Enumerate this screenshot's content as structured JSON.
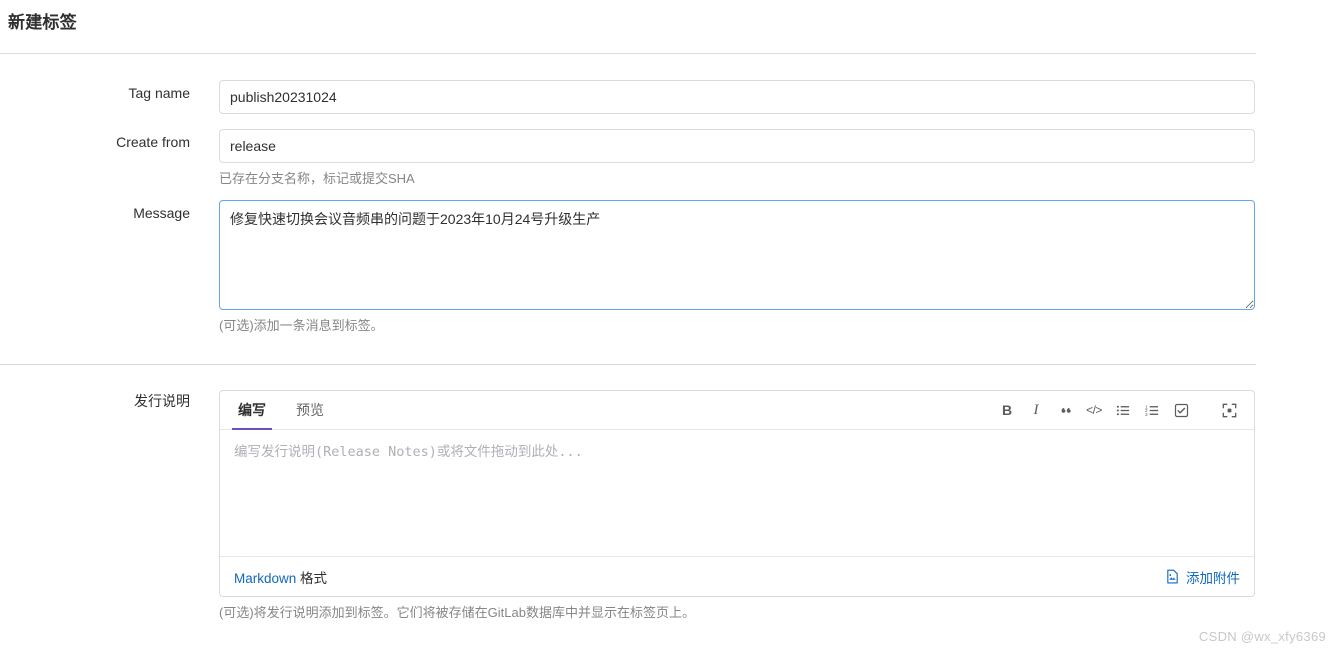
{
  "page": {
    "title": "新建标签",
    "watermark": "CSDN @wx_xfy6369"
  },
  "form": {
    "tag_name": {
      "label": "Tag name",
      "value": "publish20231024",
      "placeholder": ""
    },
    "create_from": {
      "label": "Create from",
      "value": "release",
      "placeholder": "",
      "hint": "已存在分支名称，标记或提交SHA"
    },
    "message": {
      "label": "Message",
      "value": "修复快速切换会议音频串的问题于2023年10月24号升级生产",
      "placeholder": "",
      "hint": "(可选)添加一条消息到标签。"
    },
    "release_notes": {
      "label": "发行说明",
      "tabs": [
        {
          "id": "write",
          "label": "编写",
          "active": true
        },
        {
          "id": "preview",
          "label": "预览",
          "active": false
        }
      ],
      "toolbar": [
        {
          "name": "bold-icon",
          "label": "B",
          "title": "加粗"
        },
        {
          "name": "italic-icon",
          "label": "I",
          "title": "斜体"
        },
        {
          "name": "quote-icon",
          "label": "””",
          "title": "引用"
        },
        {
          "name": "code-icon",
          "label": "</>",
          "title": "代码"
        },
        {
          "name": "bulleted-list-icon",
          "label": "",
          "title": "无序列表"
        },
        {
          "name": "numbered-list-icon",
          "label": "",
          "title": "有序列表"
        },
        {
          "name": "task-list-icon",
          "label": "",
          "title": "任务列表"
        },
        {
          "name": "fullscreen-icon",
          "label": "",
          "title": "全屏"
        }
      ],
      "placeholder": "编写发行说明(Release Notes)或将文件拖动到此处...",
      "value": "",
      "markdown_link": "Markdown",
      "markdown_suffix": " 格式",
      "attach_label": "添加附件",
      "attach_icon": "image-file-icon",
      "hint": "(可选)将发行说明添加到标签。它们将被存储在GitLab数据库中并显示在标签页上。"
    }
  },
  "colors": {
    "accent": "#6b4fbb",
    "link": "#1068bf",
    "focus_border": "#63a6e9",
    "border": "#dbdbdb",
    "text": "#303030",
    "muted": "#868686",
    "watermark": "#c8c8c8"
  }
}
